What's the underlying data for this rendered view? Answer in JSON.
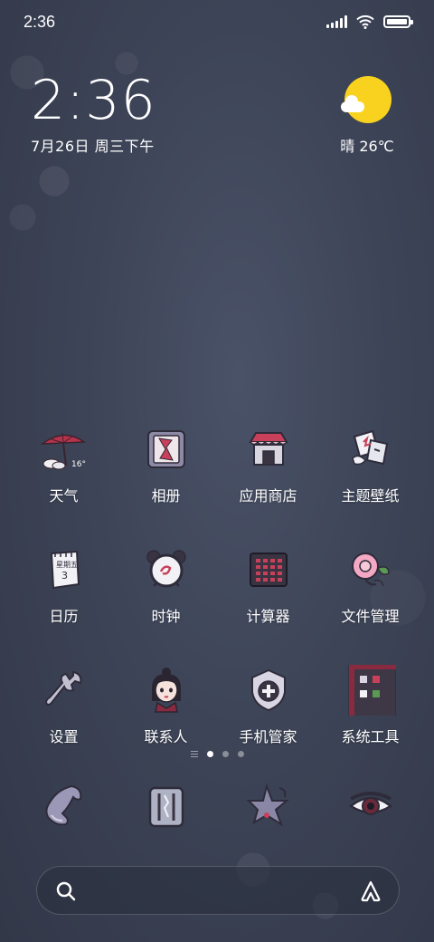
{
  "status_bar": {
    "time": "2:36",
    "battery_level": 1.0
  },
  "clock_widget": {
    "time": "2:36",
    "date": "7月26日 周三下午"
  },
  "weather_widget": {
    "icon": "sun-with-cloud-icon",
    "condition_temp": "晴 26℃",
    "sun_color": "#f8d21e"
  },
  "apps": [
    {
      "label": "天气",
      "icon": "weather-umbrella-icon",
      "badge": "16°"
    },
    {
      "label": "相册",
      "icon": "gallery-icon"
    },
    {
      "label": "应用商店",
      "icon": "app-store-house-icon"
    },
    {
      "label": "主题壁纸",
      "icon": "themes-icon"
    },
    {
      "label": "日历",
      "icon": "calendar-icon",
      "day_name": "星期五",
      "day": "3"
    },
    {
      "label": "时钟",
      "icon": "clock-icon"
    },
    {
      "label": "计算器",
      "icon": "calculator-icon"
    },
    {
      "label": "文件管理",
      "icon": "file-manager-flower-icon"
    },
    {
      "label": "设置",
      "icon": "settings-wrench-icon"
    },
    {
      "label": "联系人",
      "icon": "contacts-girl-icon"
    },
    {
      "label": "手机管家",
      "icon": "security-shield-icon"
    },
    {
      "label": "系统工具",
      "icon": "system-tools-folder-icon"
    }
  ],
  "page_indicator": {
    "pages": 3,
    "active": 0
  },
  "dock": [
    {
      "icon": "phone-icon"
    },
    {
      "icon": "messages-icon"
    },
    {
      "icon": "browser-star-icon"
    },
    {
      "icon": "camera-eye-icon"
    }
  ],
  "search_bar": {
    "search_icon": "search-icon",
    "assistant_icon": "assistant-icon"
  }
}
